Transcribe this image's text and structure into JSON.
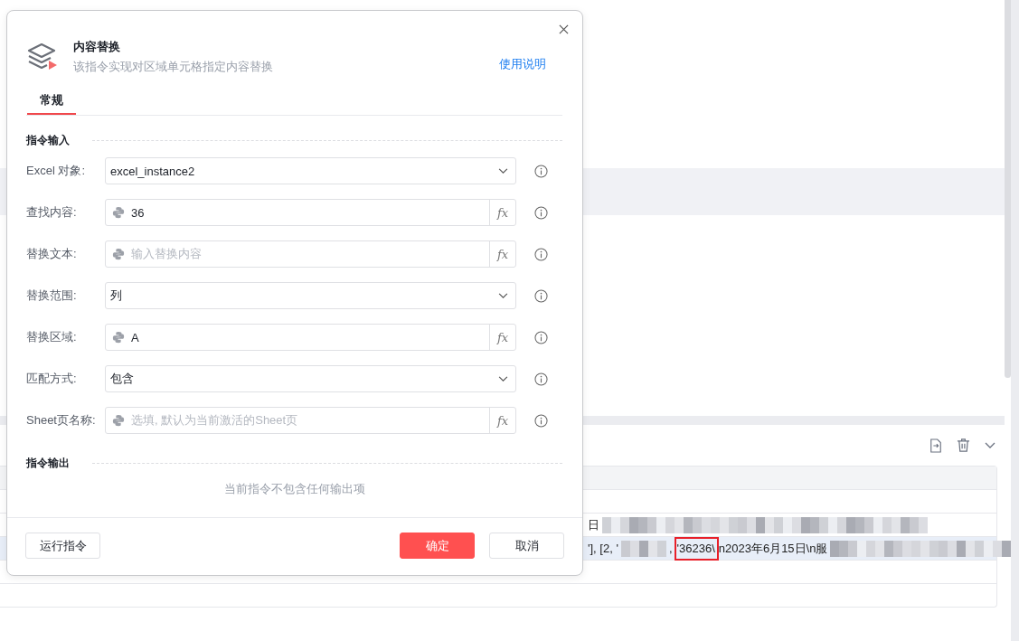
{
  "dialog": {
    "title": "内容替换",
    "subtitle": "该指令实现对区域单元格指定内容替换",
    "help_link": "使用说明",
    "tabs": [
      {
        "label": "常规",
        "selected": true
      }
    ],
    "input_section": "指令输入",
    "fields": [
      {
        "label": "Excel 对象:",
        "kind": "select",
        "value": "excel_instance2"
      },
      {
        "label": "查找内容:",
        "kind": "python",
        "value": "36",
        "fx": "fx"
      },
      {
        "label": "替换文本:",
        "kind": "python",
        "placeholder": "输入替换内容",
        "fx": "fx"
      },
      {
        "label": "替换范围:",
        "kind": "select",
        "value": "列"
      },
      {
        "label": "替换区域:",
        "kind": "python",
        "value": "A",
        "fx": "fx"
      },
      {
        "label": "匹配方式:",
        "kind": "select",
        "value": "包含"
      },
      {
        "label": "Sheet页名称:",
        "kind": "python",
        "placeholder": "选填, 默认为当前激活的Sheet页",
        "fx": "fx"
      }
    ],
    "output_section": "指令输出",
    "output_empty": "当前指令不包含任何输出项",
    "buttons": [
      {
        "label": "运行指令",
        "kind": "default"
      },
      {
        "label": "确定",
        "kind": "primary"
      },
      {
        "label": "取消",
        "kind": "default"
      }
    ]
  },
  "log_table": {
    "rows": [
      {
        "selected": false
      },
      {
        "selected": false,
        "segments": [
          {
            "kind": "text",
            "text": "日"
          },
          {
            "kind": "blur"
          }
        ]
      },
      {
        "selected": true,
        "segments": [
          {
            "kind": "text",
            "text": "'], [2, '"
          },
          {
            "kind": "blur"
          },
          {
            "kind": "text",
            "text": ","
          },
          {
            "kind": "text",
            "text": "'36236\\",
            "highlighted": true
          },
          {
            "kind": "text",
            "text": "n2023年6月15日\\n服"
          },
          {
            "kind": "blur"
          }
        ]
      },
      {
        "selected": false
      },
      {
        "selected": false
      }
    ]
  }
}
